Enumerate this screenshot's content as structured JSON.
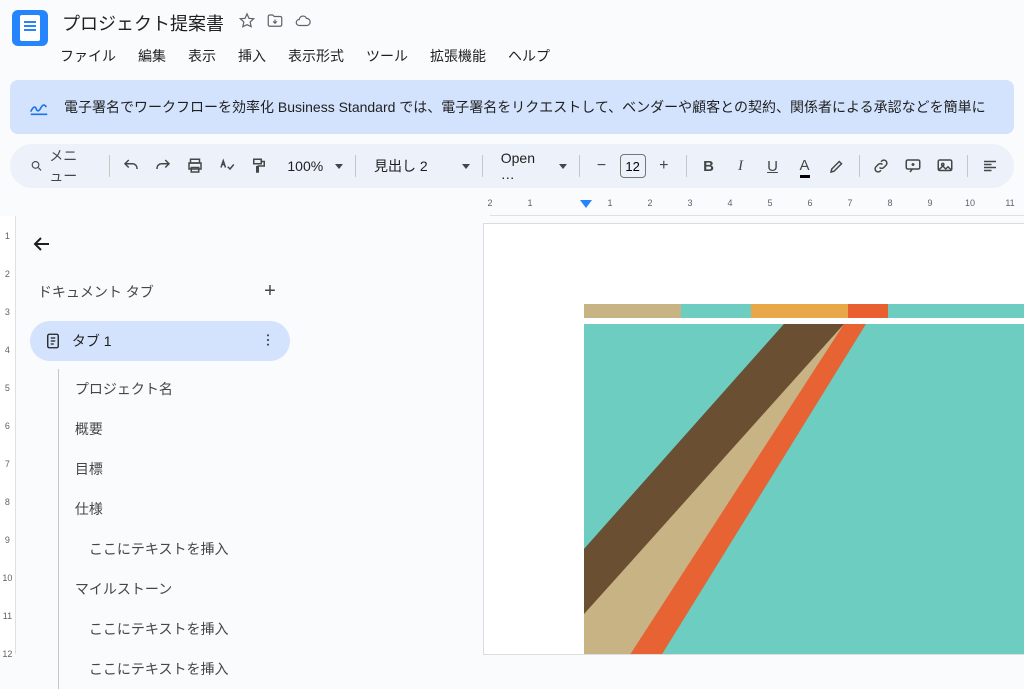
{
  "header": {
    "title": "プロジェクト提案書",
    "menus": [
      "ファイル",
      "編集",
      "表示",
      "挿入",
      "表示形式",
      "ツール",
      "拡張機能",
      "ヘルプ"
    ]
  },
  "banner": {
    "text": "電子署名でワークフローを効率化  Business Standard では、電子署名をリクエストして、ベンダーや顧客との契約、関係者による承認などを簡単に"
  },
  "toolbar": {
    "search_label": "メニュー",
    "zoom": "100%",
    "style": "見出し 2",
    "font": "Open …",
    "size": "12"
  },
  "ruler": {
    "ticksTop": [
      "2",
      "1",
      "",
      "1",
      "2",
      "3",
      "4",
      "5",
      "6",
      "7",
      "8",
      "9",
      "10",
      "11"
    ],
    "ticksLeft": [
      "1",
      "2",
      "3",
      "4",
      "5",
      "6",
      "7",
      "8",
      "9",
      "10",
      "11",
      "12"
    ]
  },
  "sidepanel": {
    "back": "←",
    "header": "ドキュメント タブ",
    "tab_label": "タブ 1",
    "outline": [
      {
        "text": "プロジェクト名",
        "indent": false
      },
      {
        "text": "概要",
        "indent": false
      },
      {
        "text": "目標",
        "indent": false
      },
      {
        "text": "仕様",
        "indent": false
      },
      {
        "text": "ここにテキストを挿入",
        "indent": true
      },
      {
        "text": "マイルストーン",
        "indent": false
      },
      {
        "text": "ここにテキストを挿入",
        "indent": true
      },
      {
        "text": "ここにテキストを挿入",
        "indent": true
      }
    ]
  },
  "colors": {
    "tan": "#c8b384",
    "teal": "#6dcdc0",
    "orange": "#e95f2f",
    "gold": "#e8a84a",
    "darkTeal": "#2f746c",
    "brown": "#6b4f33"
  }
}
